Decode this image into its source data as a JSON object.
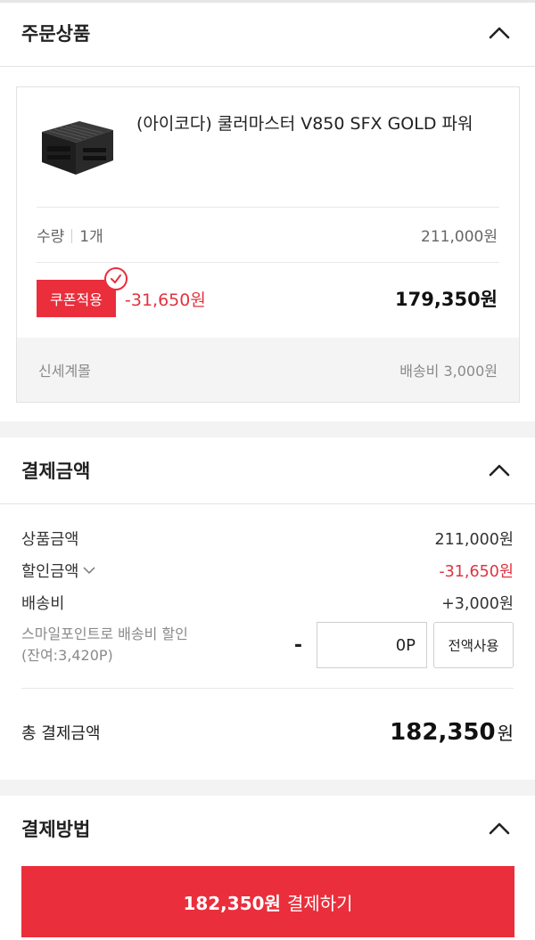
{
  "order_section": {
    "title": "주문상품",
    "product": {
      "name": "(아이코다) 쿨러마스터 V850 SFX GOLD 파워",
      "qty_label": "수량",
      "qty_value": "1개",
      "unit_price": "211,000원",
      "coupon_label": "쿠폰적용",
      "coupon_discount": "-31,650원",
      "final_price": "179,350원",
      "seller": "신세계몰",
      "shipping": "배송비 3,000원"
    }
  },
  "amount_section": {
    "title": "결제금액",
    "rows": {
      "product_label": "상품금액",
      "product_value": "211,000원",
      "discount_label": "할인금액",
      "discount_value": "-31,650원",
      "shipping_label": "배송비",
      "shipping_value": "+3,000원"
    },
    "points": {
      "label_line1": "스마일포인트로 배송비 할인",
      "label_line2": "(잔여:3,420P)",
      "minus": "-",
      "value": "0P",
      "use_all": "전액사용"
    },
    "total": {
      "label": "총 결제금액",
      "amount": "182,350",
      "unit": "원"
    }
  },
  "method_section": {
    "title": "결제방법"
  },
  "pay_button": {
    "amount": "182,350원",
    "label": "결제하기"
  },
  "colors": {
    "accent": "#ea2e3c",
    "discount_text": "#e03340"
  }
}
